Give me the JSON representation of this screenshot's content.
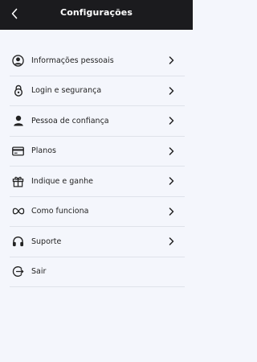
{
  "header": {
    "title": "Configurações",
    "back_icon": "chevron-left-icon",
    "background": "#1b1b1e"
  },
  "menu": {
    "items": [
      {
        "label": "Informações pessoais",
        "icon": "user-circle-icon",
        "has_chevron": true
      },
      {
        "label": "Login e segurança",
        "icon": "lock-icon",
        "has_chevron": true
      },
      {
        "label": "Pessoa de confiança",
        "icon": "person-icon",
        "has_chevron": true
      },
      {
        "label": "Planos",
        "icon": "credit-card-icon",
        "has_chevron": true
      },
      {
        "label": "Indique e ganhe",
        "icon": "gift-icon",
        "has_chevron": true
      },
      {
        "label": "Como funciona",
        "icon": "infinity-icon",
        "has_chevron": true
      },
      {
        "label": "Suporte",
        "icon": "headphones-icon",
        "has_chevron": true
      },
      {
        "label": "Sair",
        "icon": "logout-icon",
        "has_chevron": false
      }
    ]
  },
  "colors": {
    "page_background": "#f4f6fc",
    "divider": "#dfe2ea",
    "text": "#232323"
  }
}
